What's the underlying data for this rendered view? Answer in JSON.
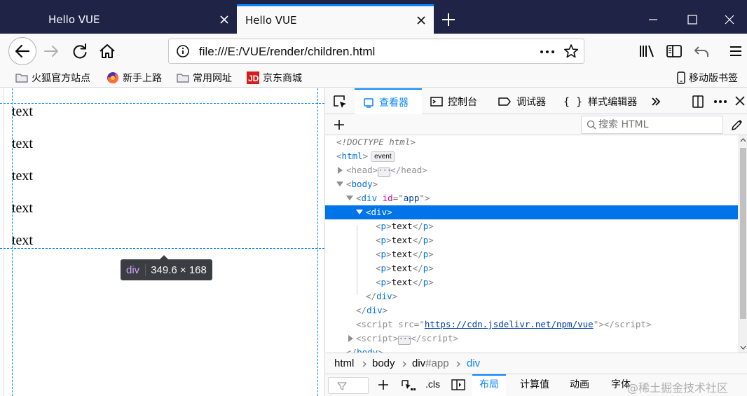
{
  "tabs": [
    {
      "title": "Hello VUE",
      "active": false
    },
    {
      "title": "Hello VUE",
      "active": true
    }
  ],
  "navbar": {
    "url": "file:///E:/VUE/render/children.html"
  },
  "bookmarks": [
    {
      "label": "火狐官方站点",
      "icon": "folder-icon"
    },
    {
      "label": "新手上路",
      "icon": "firefox-icon"
    },
    {
      "label": "常用网址",
      "icon": "folder-icon"
    },
    {
      "label": "京东商城",
      "icon": "jd-icon"
    },
    {
      "label": "移动版书签",
      "icon": "mobile-icon"
    }
  ],
  "page": {
    "paragraphs": [
      "text",
      "text",
      "text",
      "text",
      "text"
    ],
    "tooltip": {
      "tag": "div",
      "size": "349.6 × 168"
    }
  },
  "devtools": {
    "tabs": [
      "查看器",
      "控制台",
      "调试器",
      "样式编辑器"
    ],
    "search_placeholder": "搜索 HTML",
    "tree": {
      "doctype": "<!DOCTYPE html>",
      "html_badge": "event",
      "text_content": "text",
      "app_id": "app",
      "script_src": "https://cdn.jsdelivr.net/npm/vue"
    },
    "breadcrumb": [
      {
        "tag": "html",
        "id": ""
      },
      {
        "tag": "body",
        "id": ""
      },
      {
        "tag": "div",
        "id": "#app"
      },
      {
        "tag": "div",
        "id": ""
      }
    ],
    "bottom_tabs": [
      "布局",
      "计算值",
      "动画",
      "字体"
    ],
    "cls_label": ".cls"
  },
  "watermark": "@稀土掘金技术社区",
  "colors": {
    "tabstrip": "#1f2447",
    "accent": "#0a84ff",
    "selection": "#0074e8",
    "guide": "#0a84ff"
  }
}
